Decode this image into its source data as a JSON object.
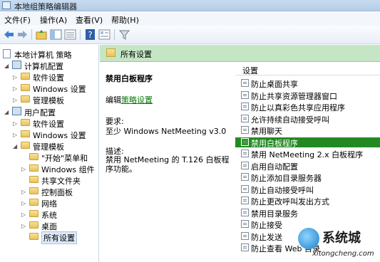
{
  "window": {
    "title": "本地组策略编辑器"
  },
  "menu": [
    "文件(F)",
    "操作(A)",
    "查看(V)",
    "帮助(H)"
  ],
  "tree": {
    "root": "本地计算机 策略",
    "computer_config": "计算机配置",
    "computer_children": [
      "软件设置",
      "Windows 设置",
      "管理模板"
    ],
    "user_config": "用户配置",
    "user_children": [
      "软件设置",
      "Windows 设置",
      "管理模板"
    ],
    "admin_templates_children": [
      "\"开始\"菜单和",
      "Windows 组件",
      "共享文件夹",
      "控制面板",
      "网络",
      "系统",
      "桌面",
      "所有设置"
    ],
    "selected": "所有设置"
  },
  "main": {
    "header_title": "所有设置",
    "policy_title": "禁用白板程序",
    "edit_prefix": "编辑",
    "edit_link": "策略设置",
    "requirements_heading": "要求:",
    "requirements_text": "至少 Windows NetMeeting v3.0",
    "description_heading": "描述:",
    "description_text": "禁用 NetMeeting 的 T.126 白板程序功能。"
  },
  "settings": {
    "column_header": "设置",
    "items": [
      "防止桌面共享",
      "防止共享资源管理器窗口",
      "防止以真彩色共享应用程序",
      "允许持续自动接受呼叫",
      "禁用聊天",
      "禁用白板程序",
      "禁用 NetMeeting 2.x 白板程序",
      "启用自动配置",
      "防止添加目录服务器",
      "防止自动接受呼叫",
      "防止更改呼叫发出方式",
      "禁用目录服务",
      "防止接受",
      "防止发送",
      "防止查看 Web 目录"
    ],
    "selected_index": 5
  },
  "watermark": {
    "brand": "系统城",
    "url": "xitongcheng.com"
  },
  "colors": {
    "header_green": "#c5e6c5",
    "selected_green": "#238a23",
    "link_green": "#0a7a0a"
  }
}
